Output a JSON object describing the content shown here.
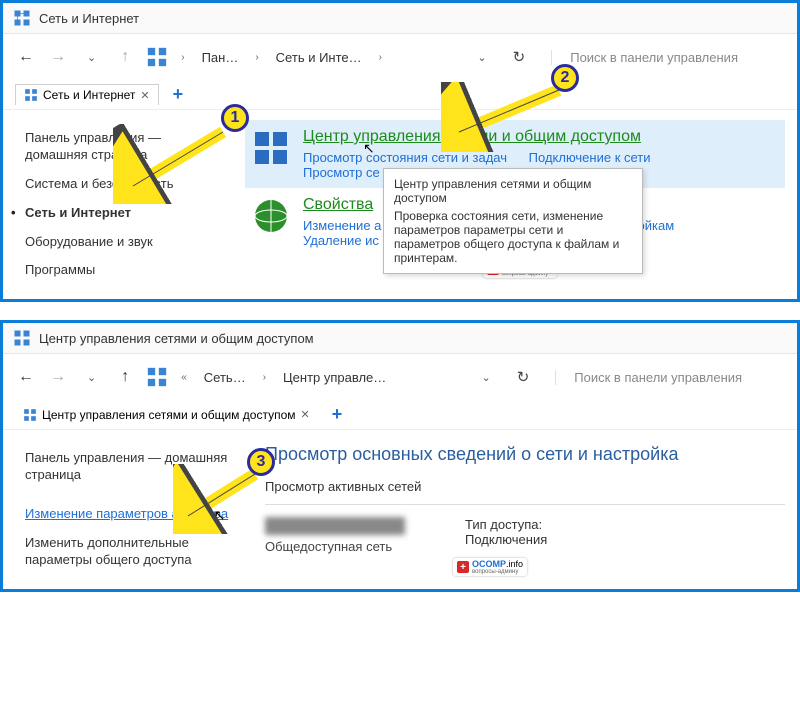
{
  "window1": {
    "title": "Сеть и Интернет",
    "breadcrumb": {
      "b1": "Пан…",
      "b2": "Сеть и Инте…"
    },
    "search_placeholder": "Поиск в панели управления",
    "tab_label": "Сеть и Интернет",
    "sidebar": [
      "Панель управления — домашняя страница",
      "Система и безопасность",
      "Сеть и Интернет",
      "Оборудование и звук",
      "Программы"
    ],
    "cat1": {
      "title": "Центр управления сетями и общим доступом",
      "l1": "Просмотр состояния сети и задач",
      "l2": "Подключение к сети",
      "l3": "Просмотр се"
    },
    "cat2": {
      "title": "Свойства",
      "l1": "Изменение а",
      "l2": "адстройкам",
      "l3": "Удаление ис"
    },
    "tooltip": {
      "t1": "Центр управления сетями и общим доступом",
      "t2": "Проверка состояния сети, изменение параметров параметры сети и параметров общего доступа к файлам и принтерам."
    }
  },
  "window2": {
    "title": "Центр управления сетями и общим доступом",
    "breadcrumb": {
      "b1": "Сеть…",
      "b2": "Центр управле…"
    },
    "search_placeholder": "Поиск в панели управления",
    "tab_label": "Центр управления сетями и общим доступом",
    "sidebar": {
      "s1": "Панель управления — домашняя страница",
      "s2": "Изменение параметров адаптера",
      "s3": "Изменить дополнительные параметры общего доступа"
    },
    "page_title": "Просмотр основных сведений о сети и настройка",
    "subhead": "Просмотр активных сетей",
    "net_type": "Общедоступная сеть",
    "r1": "Тип доступа:",
    "r2": "Подключения"
  },
  "badges": {
    "b1": "1",
    "b2": "2",
    "b3": "3"
  },
  "watermark": {
    "brand": "OCOMP",
    "suffix": ".info",
    "sub": "вопросы-админу"
  }
}
